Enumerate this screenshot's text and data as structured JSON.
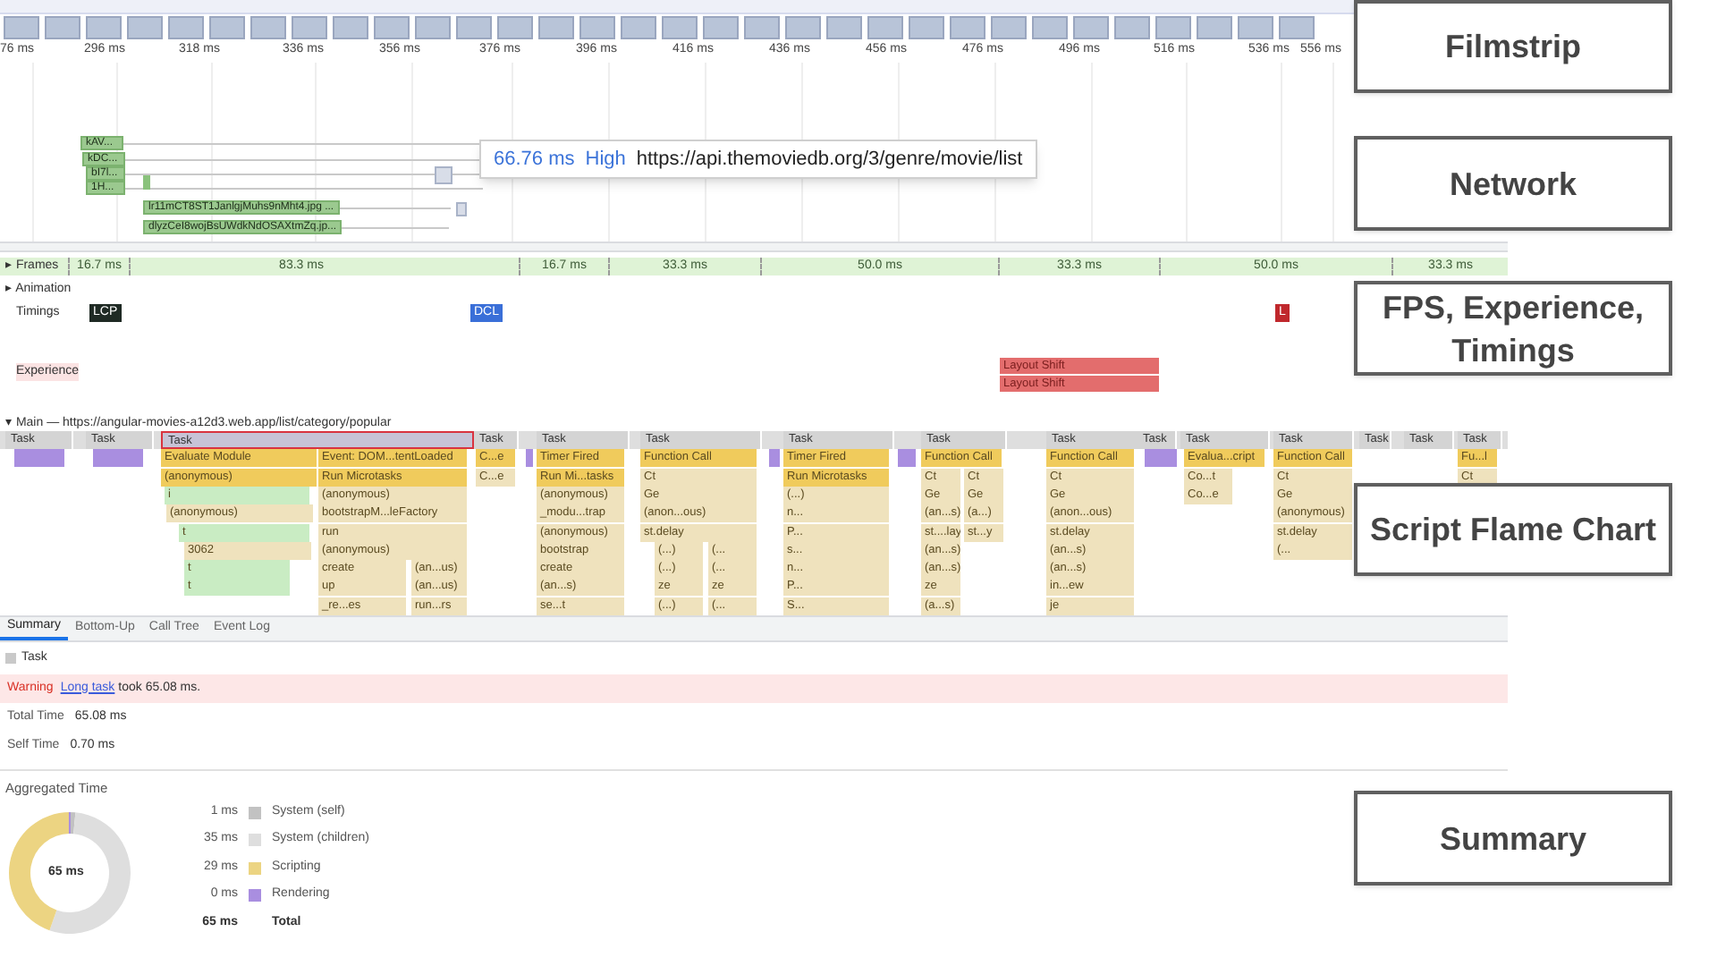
{
  "ruler": [
    "76 ms",
    "296 ms",
    "318 ms",
    "336 ms",
    "356 ms",
    "376 ms",
    "396 ms",
    "416 ms",
    "436 ms",
    "456 ms",
    "476 ms",
    "496 ms",
    "516 ms",
    "536 ms",
    "556 ms"
  ],
  "network": {
    "rows": [
      {
        "label": "kAV..."
      },
      {
        "label": "kDC..."
      },
      {
        "label": "bI7l..."
      },
      {
        "label": "1H..."
      },
      {
        "label": "lr11mCT8ST1JanlgjMuhs9nMht4.jpg ..."
      },
      {
        "label": "dlyzCeI8wojBsUWdkNdOSAXtmZq.jp..."
      }
    ],
    "tooltip": {
      "duration": "66.76 ms",
      "priority": "High",
      "url": "https://api.themoviedb.org/3/genre/movie/list"
    }
  },
  "tracks": {
    "frames": {
      "toggle": "▸",
      "label": "Frames",
      "segments": [
        "16.7 ms",
        "83.3 ms",
        "16.7 ms",
        "33.3 ms",
        "50.0 ms",
        "33.3 ms",
        "50.0 ms",
        "33.3 ms"
      ]
    },
    "animation": {
      "toggle": "▸",
      "label": "Animation"
    },
    "timings": {
      "label": "Timings",
      "markers": [
        {
          "label": "LCP",
          "color": "#1f2a24"
        },
        {
          "label": "DCL",
          "color": "#3a6fd8"
        },
        {
          "label": "L",
          "color": "#c0282d"
        }
      ]
    },
    "experience": {
      "label": "Experience",
      "shifts": [
        "Layout Shift",
        "Layout Shift"
      ]
    },
    "main": {
      "toggle": "▾",
      "label": "Main — https://angular-movies-a12d3.web.app/list/category/popular",
      "tasks": [
        {
          "label": "Task",
          "selected": false
        },
        {
          "label": "Task",
          "selected": false
        },
        {
          "label": "Task",
          "selected": true,
          "lanes": [
            {
              "kind": "script",
              "entries": [
                "Evaluate Module",
                "(anonymous)"
              ]
            },
            {
              "kind": "compile",
              "entries": [
                "i"
              ]
            },
            {
              "kind": "script",
              "entries": [
                "(anonymous)"
              ]
            },
            {
              "kind": "compile",
              "entries": [
                "t"
              ]
            },
            {
              "kind": "script",
              "entries": [
                "3062"
              ]
            },
            {
              "kind": "compile",
              "entries": [
                "t",
                "t"
              ]
            },
            {
              "kind": "script",
              "entries": [
                "Event: DOM...tentLoaded",
                "Run Microtasks",
                "(anonymous)",
                "bootstrapM...leFactory",
                "run",
                "(anonymous)"
              ]
            },
            {
              "kind": "script",
              "entries": [
                "create",
                "up",
                "_re...es"
              ]
            },
            {
              "kind": "script",
              "entries": [
                "(an...us)",
                "(an...us)",
                "run...rs"
              ]
            }
          ]
        },
        {
          "label": "Task",
          "selected": false,
          "lanes": [
            {
              "kind": "script",
              "entries": [
                "C...e",
                "C...e"
              ]
            }
          ]
        },
        {
          "label": "Task",
          "selected": false,
          "lanes": [
            {
              "kind": "script",
              "entries": [
                "Timer Fired",
                "Run Mi...tasks",
                "(anonymous)",
                "_modu...trap",
                "(anonymous)",
                "bootstrap",
                "create",
                "(an...s)",
                "se...t"
              ]
            }
          ]
        },
        {
          "label": "Task",
          "selected": false,
          "lanes": [
            {
              "kind": "script",
              "entries": [
                "Function Call",
                "Ct",
                "Ge",
                "(anon...ous)",
                "st.delay"
              ]
            },
            {
              "kind": "script",
              "entries": [
                "(...)",
                "(...)",
                "ze",
                "(...)"
              ]
            },
            {
              "kind": "script",
              "entries": [
                "(...",
                "(...",
                "ze",
                "(..."
              ]
            }
          ]
        },
        {
          "label": "Task",
          "selected": false,
          "lanes": [
            {
              "kind": "script",
              "entries": [
                "Timer Fired",
                "Run Microtasks",
                "(...)",
                "n...",
                "P...",
                "s...",
                "n...",
                "P...",
                "S..."
              ]
            }
          ]
        },
        {
          "label": "Task",
          "selected": false,
          "lanes": [
            {
              "kind": "script",
              "entries": [
                "Function Call"
              ]
            },
            {
              "kind": "script",
              "entries": [
                "Ct",
                "Ge",
                "(an...s)",
                "st....lay",
                "(an...s)",
                "(an...s)",
                "ze",
                "(a...s)"
              ]
            },
            {
              "kind": "script",
              "entries": [
                "Ct",
                "Ge",
                "(a...)",
                "st...y"
              ]
            }
          ]
        },
        {
          "label": "Task",
          "selected": false,
          "lanes": [
            {
              "kind": "script",
              "entries": [
                "Function Call",
                "Ct",
                "Ge",
                "(anon...ous)",
                "st.delay",
                "(an...s)",
                "(an...s)",
                "in...ew",
                "je"
              ]
            }
          ]
        },
        {
          "label": "Task",
          "selected": false
        },
        {
          "label": "Task",
          "selected": false,
          "lanes": [
            {
              "kind": "script",
              "entries": [
                "Evalua...cript"
              ]
            },
            {
              "kind": "script",
              "entries": [
                "Co...t",
                "Co...e"
              ]
            }
          ]
        },
        {
          "label": "Task",
          "selected": false,
          "lanes": [
            {
              "kind": "script",
              "entries": [
                "Function Call",
                "Ct",
                "Ge",
                "(anonymous)",
                "st.delay",
                "(..."
              ]
            }
          ]
        },
        {
          "label": "Task",
          "selected": false
        },
        {
          "label": "Task",
          "selected": false
        },
        {
          "label": "Task",
          "selected": false,
          "lanes": [
            {
              "kind": "script",
              "entries": [
                "Fu...l",
                "Ct"
              ]
            }
          ]
        }
      ]
    }
  },
  "summary": {
    "tabs": [
      {
        "label": "Summary",
        "selected": true
      },
      {
        "label": "Bottom-Up",
        "selected": false
      },
      {
        "label": "Call Tree",
        "selected": false
      },
      {
        "label": "Event Log",
        "selected": false
      }
    ],
    "title": "Task",
    "warning": {
      "label": "Warning",
      "link": "Long task",
      "text": "took 65.08 ms."
    },
    "fields": [
      {
        "name": "Total Time",
        "value": "65.08 ms"
      },
      {
        "name": "Self Time",
        "value": "0.70 ms"
      }
    ],
    "aggregated": {
      "title": "Aggregated Time",
      "center": "65 ms",
      "legend": [
        {
          "value": "1 ms",
          "color": "#c2c2c2"
        },
        {
          "value": "35 ms",
          "color": "#dedede"
        },
        {
          "value": "29 ms",
          "color": "#ecd482"
        },
        {
          "value": "0 ms",
          "color": "#a98ee0"
        }
      ],
      "total": {
        "value": "65 ms",
        "name": "Total"
      },
      "chart_data": {
        "type": "donut",
        "categories": [
          "System (self)",
          "System (children)",
          "Scripting",
          "Rendering"
        ],
        "values": [
          1.5,
          53.9,
          44.6,
          0
        ]
      }
    }
  },
  "annotations": [
    "Filmstrip",
    "Network",
    "FPS, Experience, Timings",
    "Script Flame Chart",
    "Summary"
  ]
}
